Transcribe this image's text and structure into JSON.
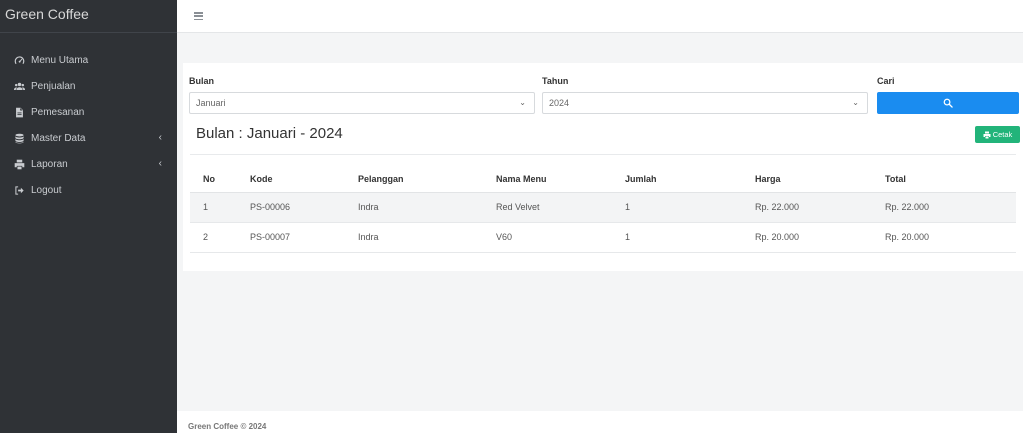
{
  "app": {
    "brand": "Green Coffee"
  },
  "sidebar": {
    "items": [
      {
        "label": "Menu Utama",
        "icon": "dashboard-icon",
        "has_submenu": false
      },
      {
        "label": "Penjualan",
        "icon": "users-icon",
        "has_submenu": false
      },
      {
        "label": "Pemesanan",
        "icon": "file-icon",
        "has_submenu": false
      },
      {
        "label": "Master Data",
        "icon": "database-icon",
        "has_submenu": true
      },
      {
        "label": "Laporan",
        "icon": "print-icon",
        "has_submenu": true
      },
      {
        "label": "Logout",
        "icon": "logout-icon",
        "has_submenu": false
      }
    ]
  },
  "filters": {
    "bulan_label": "Bulan",
    "bulan_value": "Januari",
    "tahun_label": "Tahun",
    "tahun_value": "2024",
    "cari_label": "Cari"
  },
  "report": {
    "title": "Bulan : Januari - 2024",
    "print_label": "Cetak"
  },
  "table": {
    "headers": [
      "No",
      "Kode",
      "Pelanggan",
      "Nama Menu",
      "Jumlah",
      "Harga",
      "Total"
    ],
    "rows": [
      [
        "1",
        "PS-00006",
        "Indra",
        "Red Velvet",
        "1",
        "Rp. 22.000",
        "Rp. 22.000"
      ],
      [
        "2",
        "PS-00007",
        "Indra",
        "V60",
        "1",
        "Rp. 20.000",
        "Rp. 20.000"
      ]
    ]
  },
  "footer": {
    "text": "Green Coffee © 2024"
  },
  "colors": {
    "sidebar": "#2f3236",
    "primary": "#1a8cf0",
    "success": "#22b47a"
  }
}
